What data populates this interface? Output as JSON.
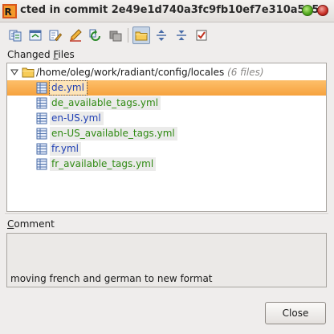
{
  "window": {
    "title": "cted in commit 2e49e1d740a3fc9fb10ef7e310a5a5a"
  },
  "toolbar": {
    "icons": [
      "diff-icon",
      "diff-window-icon",
      "edit-source-icon",
      "edit-icon",
      "refresh-icon",
      "group-icon",
      "show-directories-icon",
      "expand-all-icon",
      "collapse-all-icon",
      "checkbox-icon"
    ],
    "active": "show-directories-icon"
  },
  "changed_files": {
    "label_prefix": "Changed ",
    "label_mnemonic": "F",
    "label_suffix": "iles",
    "folder": {
      "path": "/home/oleg/work/radiant/config/locales",
      "count": "(6 files)"
    },
    "files": [
      {
        "name": "de.yml",
        "status": "modified",
        "color": "#1f3fb4",
        "selected": true
      },
      {
        "name": "de_available_tags.yml",
        "status": "added",
        "color": "#2f8a12",
        "selected": false
      },
      {
        "name": "en-US.yml",
        "status": "modified",
        "color": "#1f3fb4",
        "selected": false
      },
      {
        "name": "en-US_available_tags.yml",
        "status": "added",
        "color": "#2f8a12",
        "selected": false
      },
      {
        "name": "fr.yml",
        "status": "modified",
        "color": "#1f3fb4",
        "selected": false
      },
      {
        "name": "fr_available_tags.yml",
        "status": "added",
        "color": "#2f8a12",
        "selected": false
      }
    ]
  },
  "comment": {
    "label_mnemonic": "C",
    "label_suffix": "omment",
    "text": "moving french and german to new format"
  },
  "buttons": {
    "close_label": "Close"
  },
  "colors": {
    "selection": "#f6a23e",
    "added": "#2f8a12",
    "modified": "#1f3fb4"
  }
}
